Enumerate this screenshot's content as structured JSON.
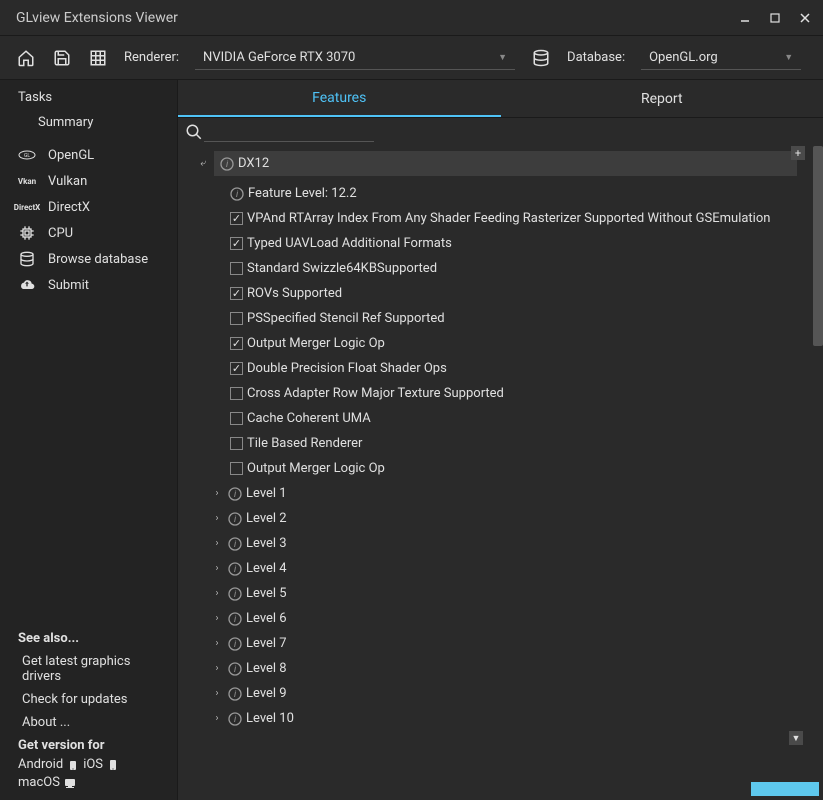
{
  "window": {
    "title": "GLview Extensions Viewer"
  },
  "toolbar": {
    "renderer_label": "Renderer:",
    "renderer_value": "NVIDIA GeForce RTX 3070",
    "database_label": "Database:",
    "database_value": "OpenGL.org"
  },
  "sidebar": {
    "tasks_header": "Tasks",
    "summary": "Summary",
    "items": [
      {
        "icon": "opengl",
        "label": "OpenGL"
      },
      {
        "icon": "vulkan",
        "label": "Vulkan"
      },
      {
        "icon": "directx",
        "label": "DirectX"
      },
      {
        "icon": "cpu",
        "label": "CPU"
      },
      {
        "icon": "database",
        "label": "Browse database"
      },
      {
        "icon": "upload",
        "label": "Submit"
      }
    ],
    "see_also_header": "See also...",
    "see_also": [
      "Get latest graphics drivers",
      "Check for updates",
      "About ..."
    ],
    "get_version_header": "Get version for",
    "platforms": {
      "android": "Android",
      "ios": "iOS",
      "macos": "macOS"
    }
  },
  "tabs": {
    "features": "Features",
    "report": "Report"
  },
  "tree": {
    "dx12": "DX12",
    "feature_level": "Feature Level: 12.2",
    "items": [
      {
        "checked": true,
        "label": "VPAnd RTArray Index From Any Shader Feeding Rasterizer Supported Without GSEmulation"
      },
      {
        "checked": true,
        "label": "Typed UAVLoad Additional Formats"
      },
      {
        "checked": false,
        "label": "Standard Swizzle64KBSupported"
      },
      {
        "checked": true,
        "label": "ROVs Supported"
      },
      {
        "checked": false,
        "label": "PSSpecified Stencil Ref Supported"
      },
      {
        "checked": true,
        "label": "Output Merger Logic Op"
      },
      {
        "checked": true,
        "label": "Double Precision Float Shader Ops"
      },
      {
        "checked": false,
        "label": "Cross Adapter Row Major Texture Supported"
      },
      {
        "checked": false,
        "label": "Cache Coherent UMA"
      },
      {
        "checked": false,
        "label": "Tile Based Renderer"
      },
      {
        "checked": false,
        "label": "Output Merger Logic Op"
      }
    ],
    "levels": [
      "Level 1",
      "Level 2",
      "Level 3",
      "Level 4",
      "Level 5",
      "Level 6",
      "Level 7",
      "Level 8",
      "Level 9",
      "Level 10"
    ]
  }
}
